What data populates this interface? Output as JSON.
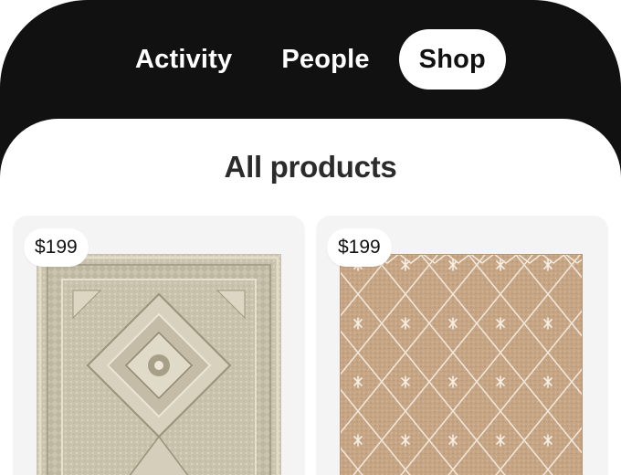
{
  "tabs": [
    {
      "label": "Activity",
      "active": false
    },
    {
      "label": "People",
      "active": false
    },
    {
      "label": "Shop",
      "active": true
    }
  ],
  "section": {
    "title": "All products"
  },
  "products": [
    {
      "price": "$199",
      "image_icon": "medallion-rug-image",
      "color": "#cfc8b4"
    },
    {
      "price": "$199",
      "image_icon": "diamond-trellis-rug-image",
      "color": "#c9a888"
    }
  ],
  "colors": {
    "header_bg": "#111111",
    "active_tab_bg": "#ffffff",
    "card_bg": "#f4f4f4"
  }
}
